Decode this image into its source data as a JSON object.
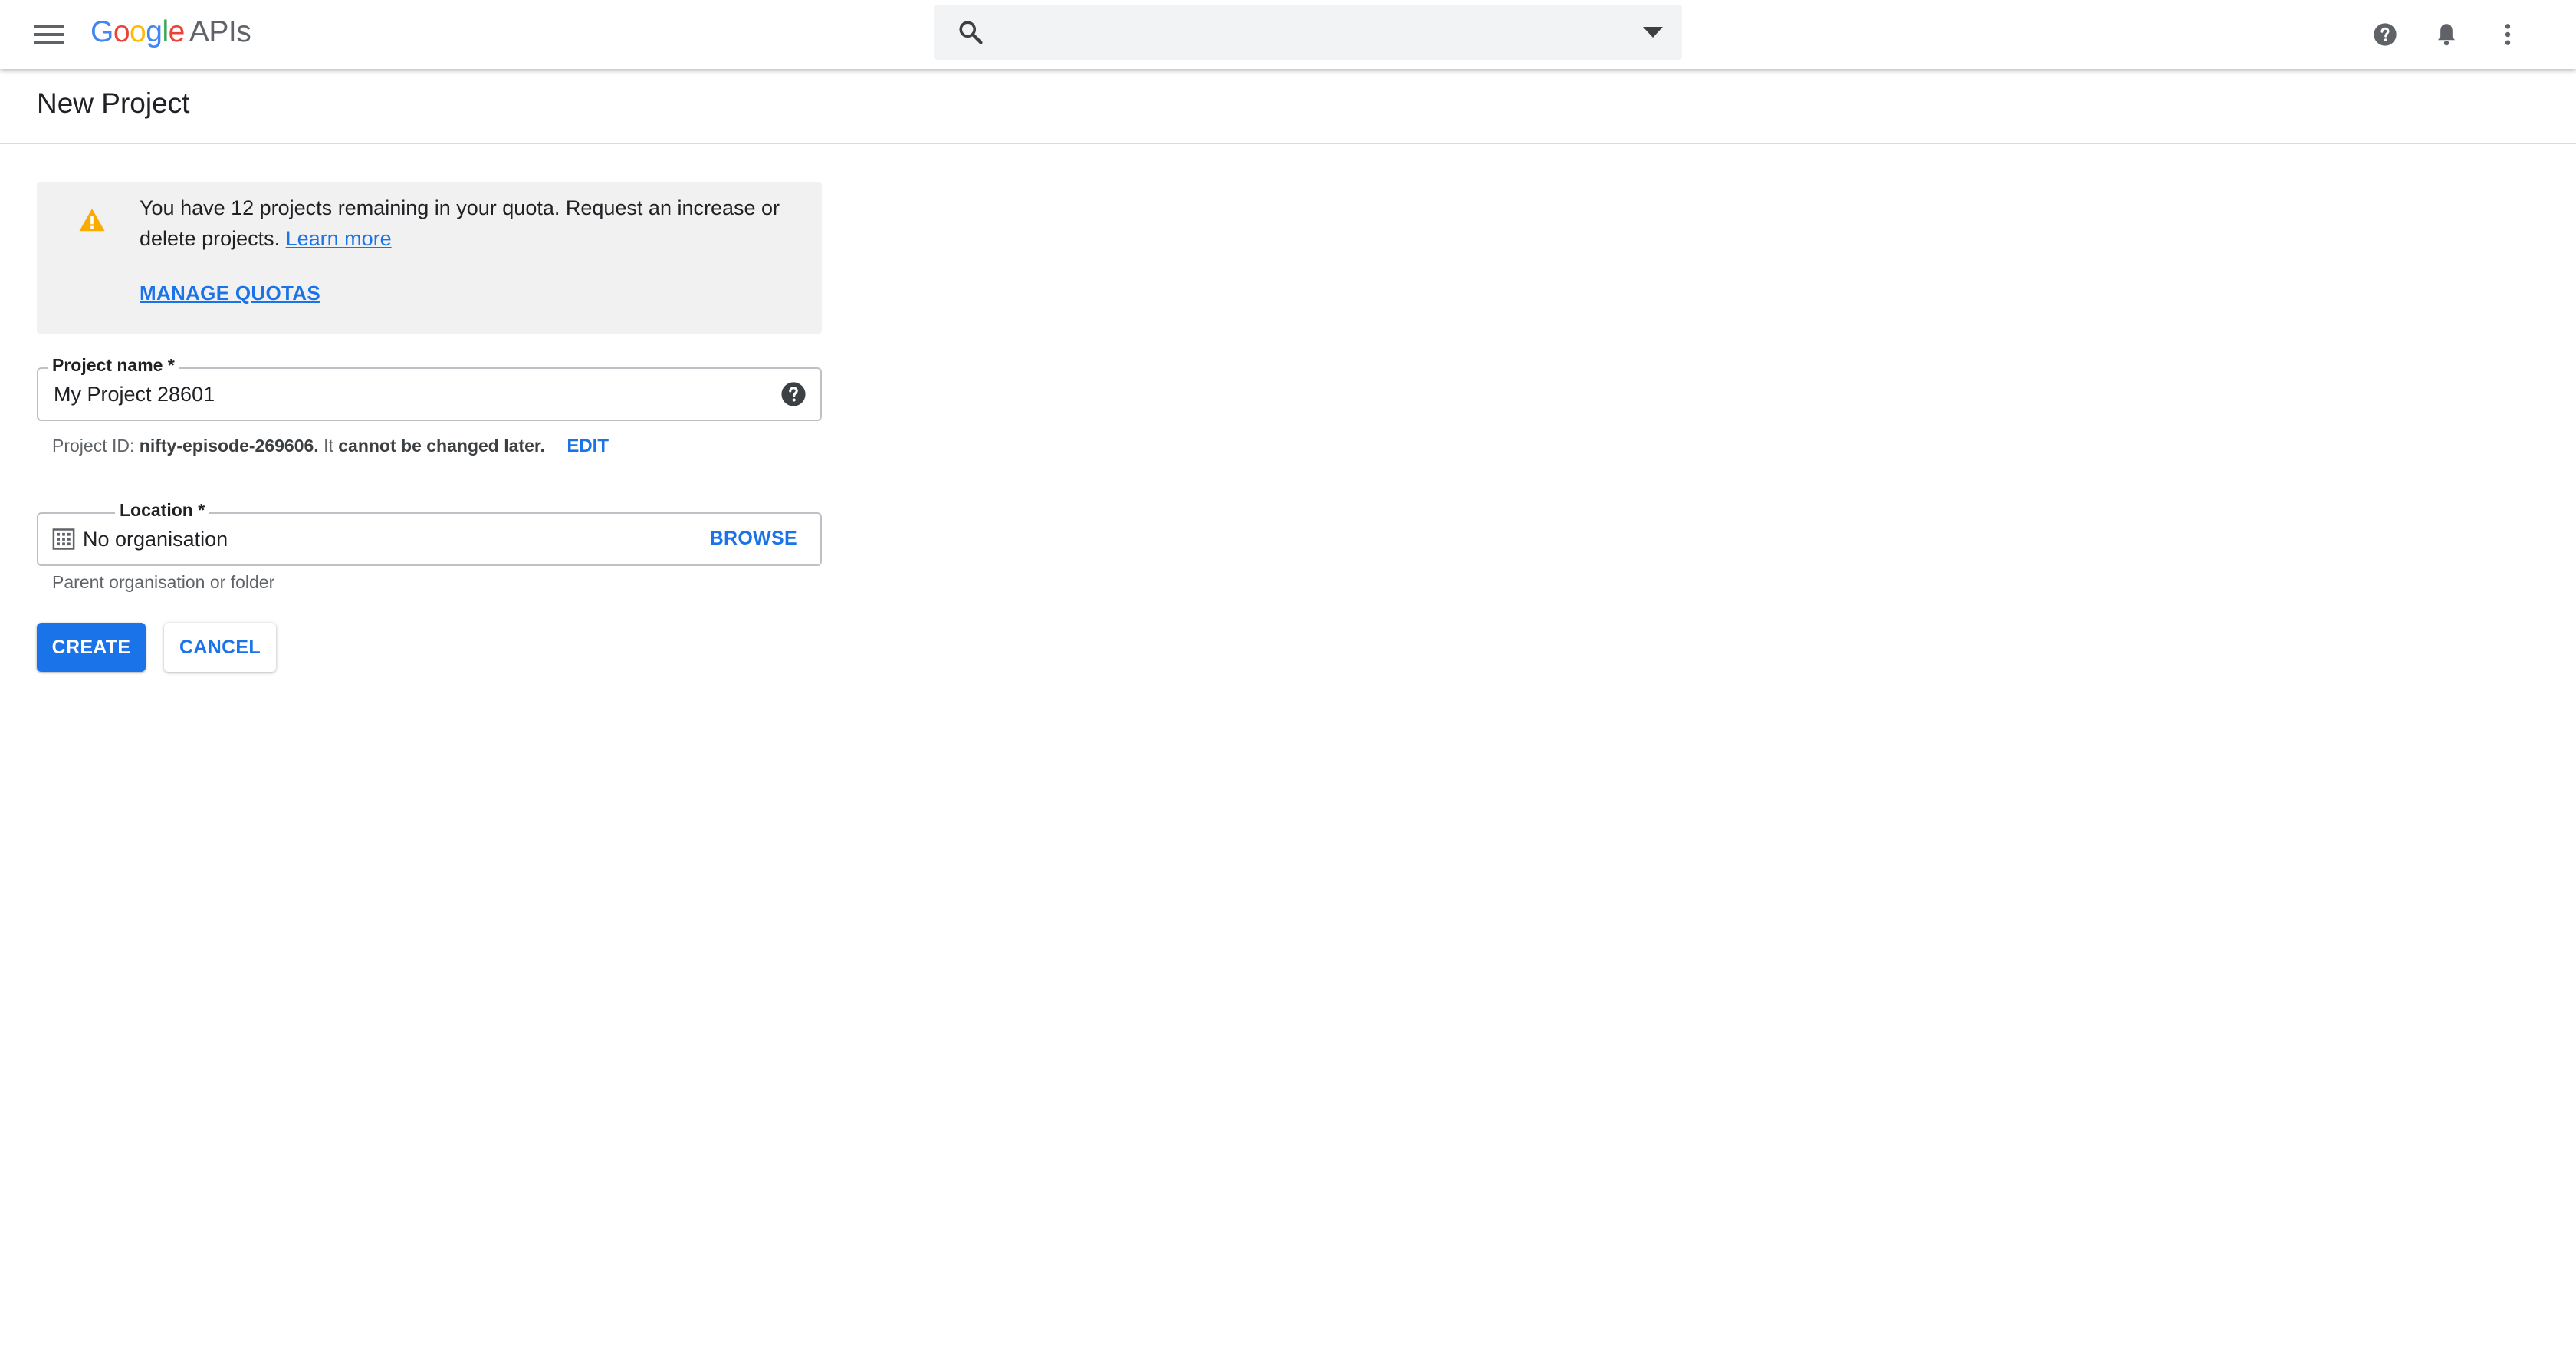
{
  "app": {
    "logo_google_letters": [
      "G",
      "o",
      "o",
      "g",
      "l",
      "e"
    ],
    "logo_suffix": "APIs",
    "colors": {
      "accent": "#1a73e8",
      "warning": "#f9ab00",
      "google_blue": "#4285f4",
      "google_red": "#ea4335",
      "google_yellow": "#fbbc05",
      "google_green": "#34a853"
    }
  },
  "topbar": {
    "menu_icon": "hamburger-menu-icon",
    "search_icon": "search-icon",
    "search_value": "",
    "search_dropdown_icon": "caret-down-icon",
    "actions": [
      {
        "name": "help",
        "icon": "help-circle-icon"
      },
      {
        "name": "notifications",
        "icon": "bell-icon"
      },
      {
        "name": "more",
        "icon": "more-vertical-icon"
      }
    ]
  },
  "page": {
    "title": "New Project"
  },
  "notice": {
    "icon": "warning-icon",
    "message": "You have 12 projects remaining in your quota. Request an increase or delete projects.",
    "learn_more": "Learn more",
    "manage_quotas": "MANAGE QUOTAS"
  },
  "form": {
    "project_name": {
      "label": "Project name *",
      "value": "My Project 28601",
      "help_icon": "help-circle-icon"
    },
    "project_id": {
      "prefix": "Project ID:",
      "id": "nifty-episode-269606.",
      "middle": "It",
      "suffix": "cannot be changed later.",
      "edit": "EDIT"
    },
    "location": {
      "label": "Location *",
      "icon": "building-icon",
      "value": "No organisation",
      "browse": "BROWSE",
      "hint": "Parent organisation or folder"
    }
  },
  "buttons": {
    "create": "CREATE",
    "cancel": "CANCEL"
  }
}
